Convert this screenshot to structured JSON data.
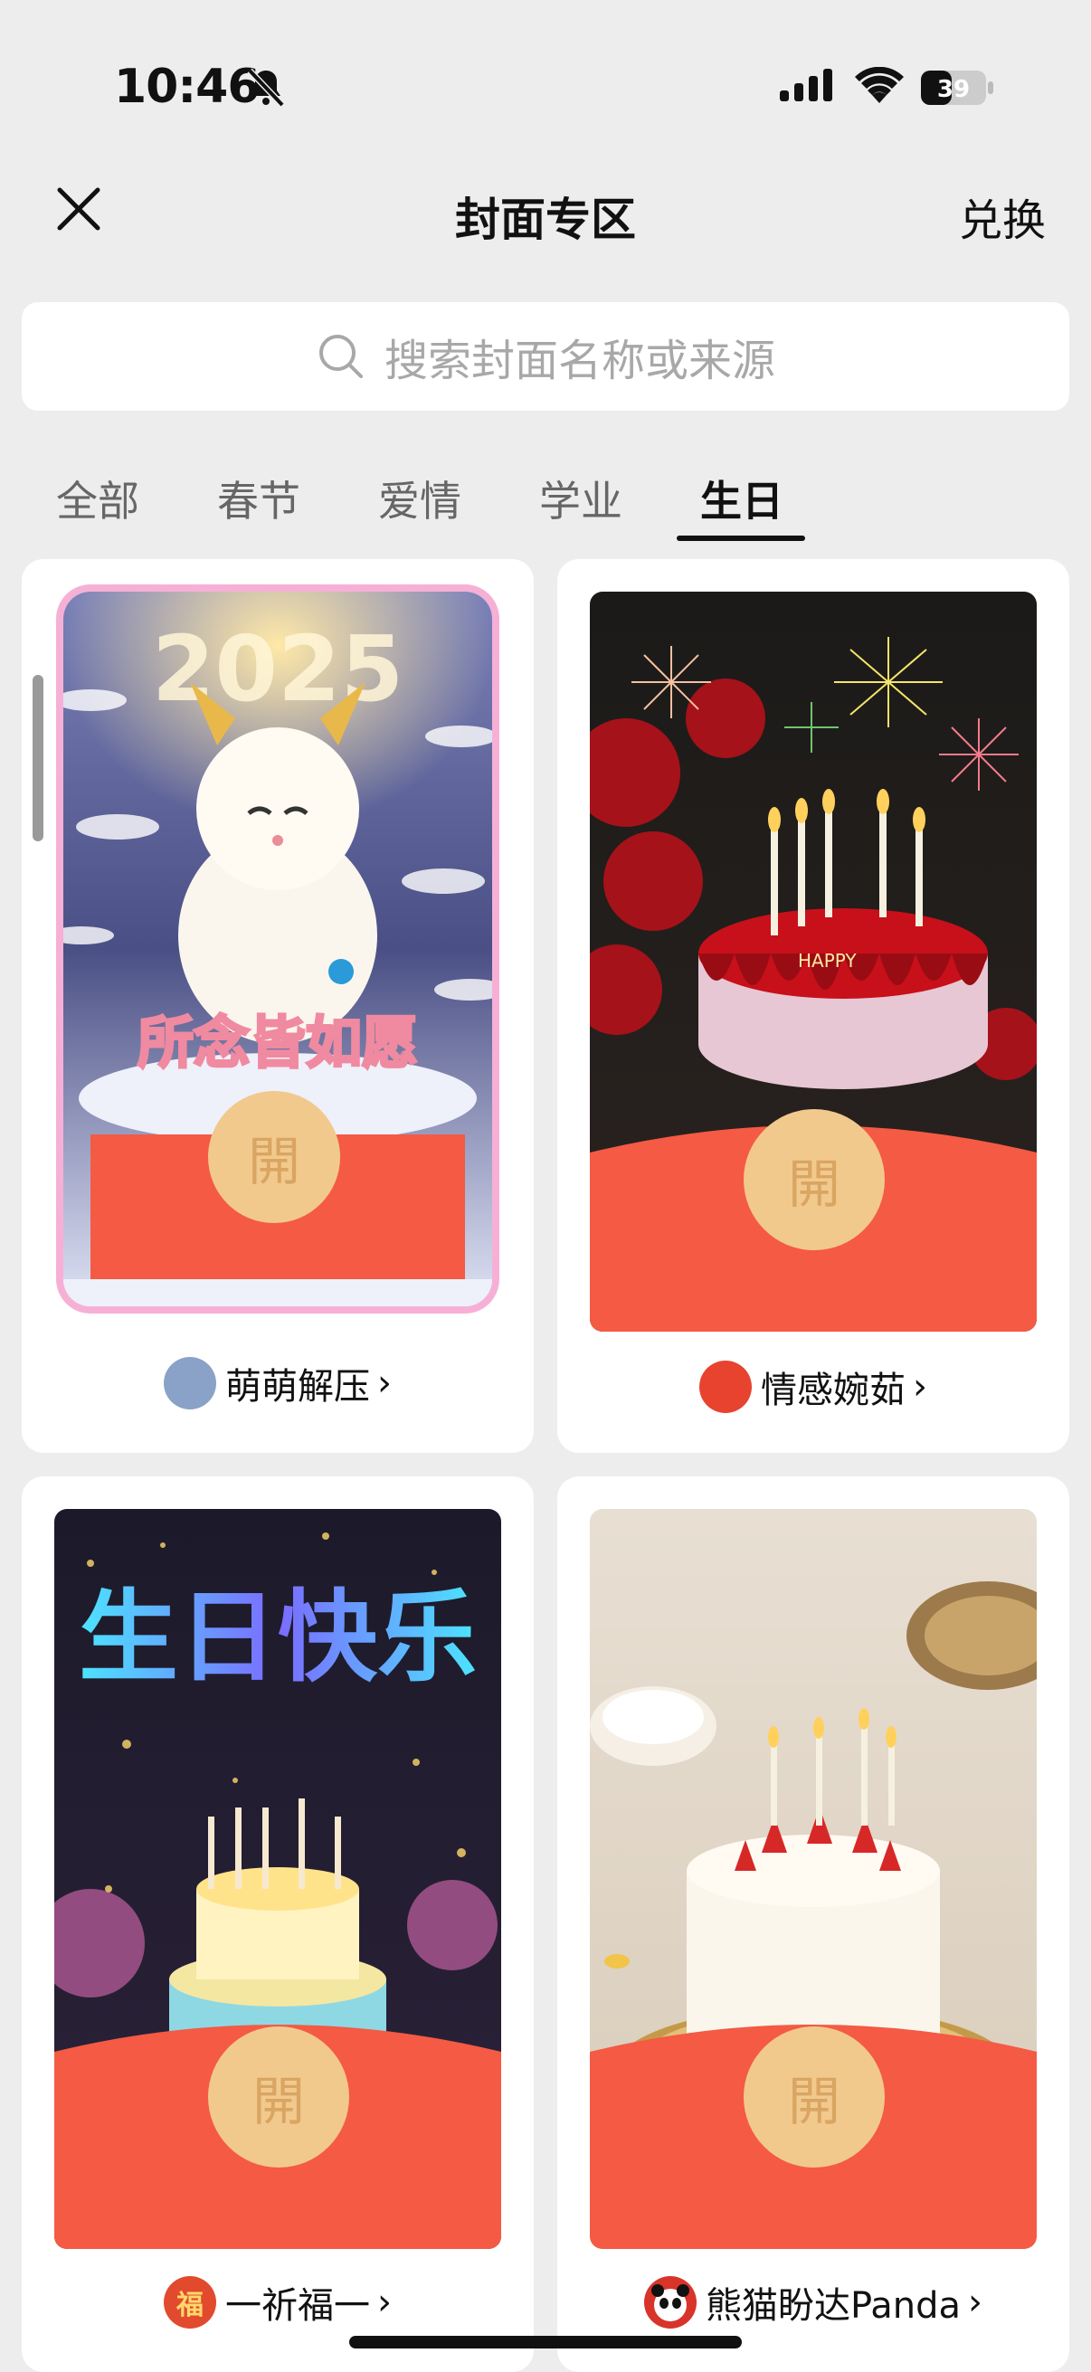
{
  "status": {
    "time": "10:46",
    "battery": "39"
  },
  "nav": {
    "title": "封面专区",
    "redeem": "兑换"
  },
  "search": {
    "placeholder": "搜索封面名称或来源"
  },
  "tabs": [
    {
      "label": "全部"
    },
    {
      "label": "春节"
    },
    {
      "label": "爱情"
    },
    {
      "label": "学业"
    },
    {
      "label": "生日",
      "active": true
    }
  ],
  "cards": [
    {
      "cover_text": "所念皆如愿",
      "year_text": "2025",
      "open_label": "開",
      "source": "萌萌解压"
    },
    {
      "cover_text": "HAPPY",
      "open_label": "開",
      "source": "情感婉茹"
    },
    {
      "cover_text": "生日快乐",
      "open_label": "開",
      "source": "一祈福一",
      "source_badge": "福"
    },
    {
      "open_label": "開",
      "source": "熊猫盼达Panda"
    }
  ],
  "colors": {
    "envelope_red": "#f45a44",
    "open_button": "#f2c98d",
    "background": "#ededed"
  }
}
